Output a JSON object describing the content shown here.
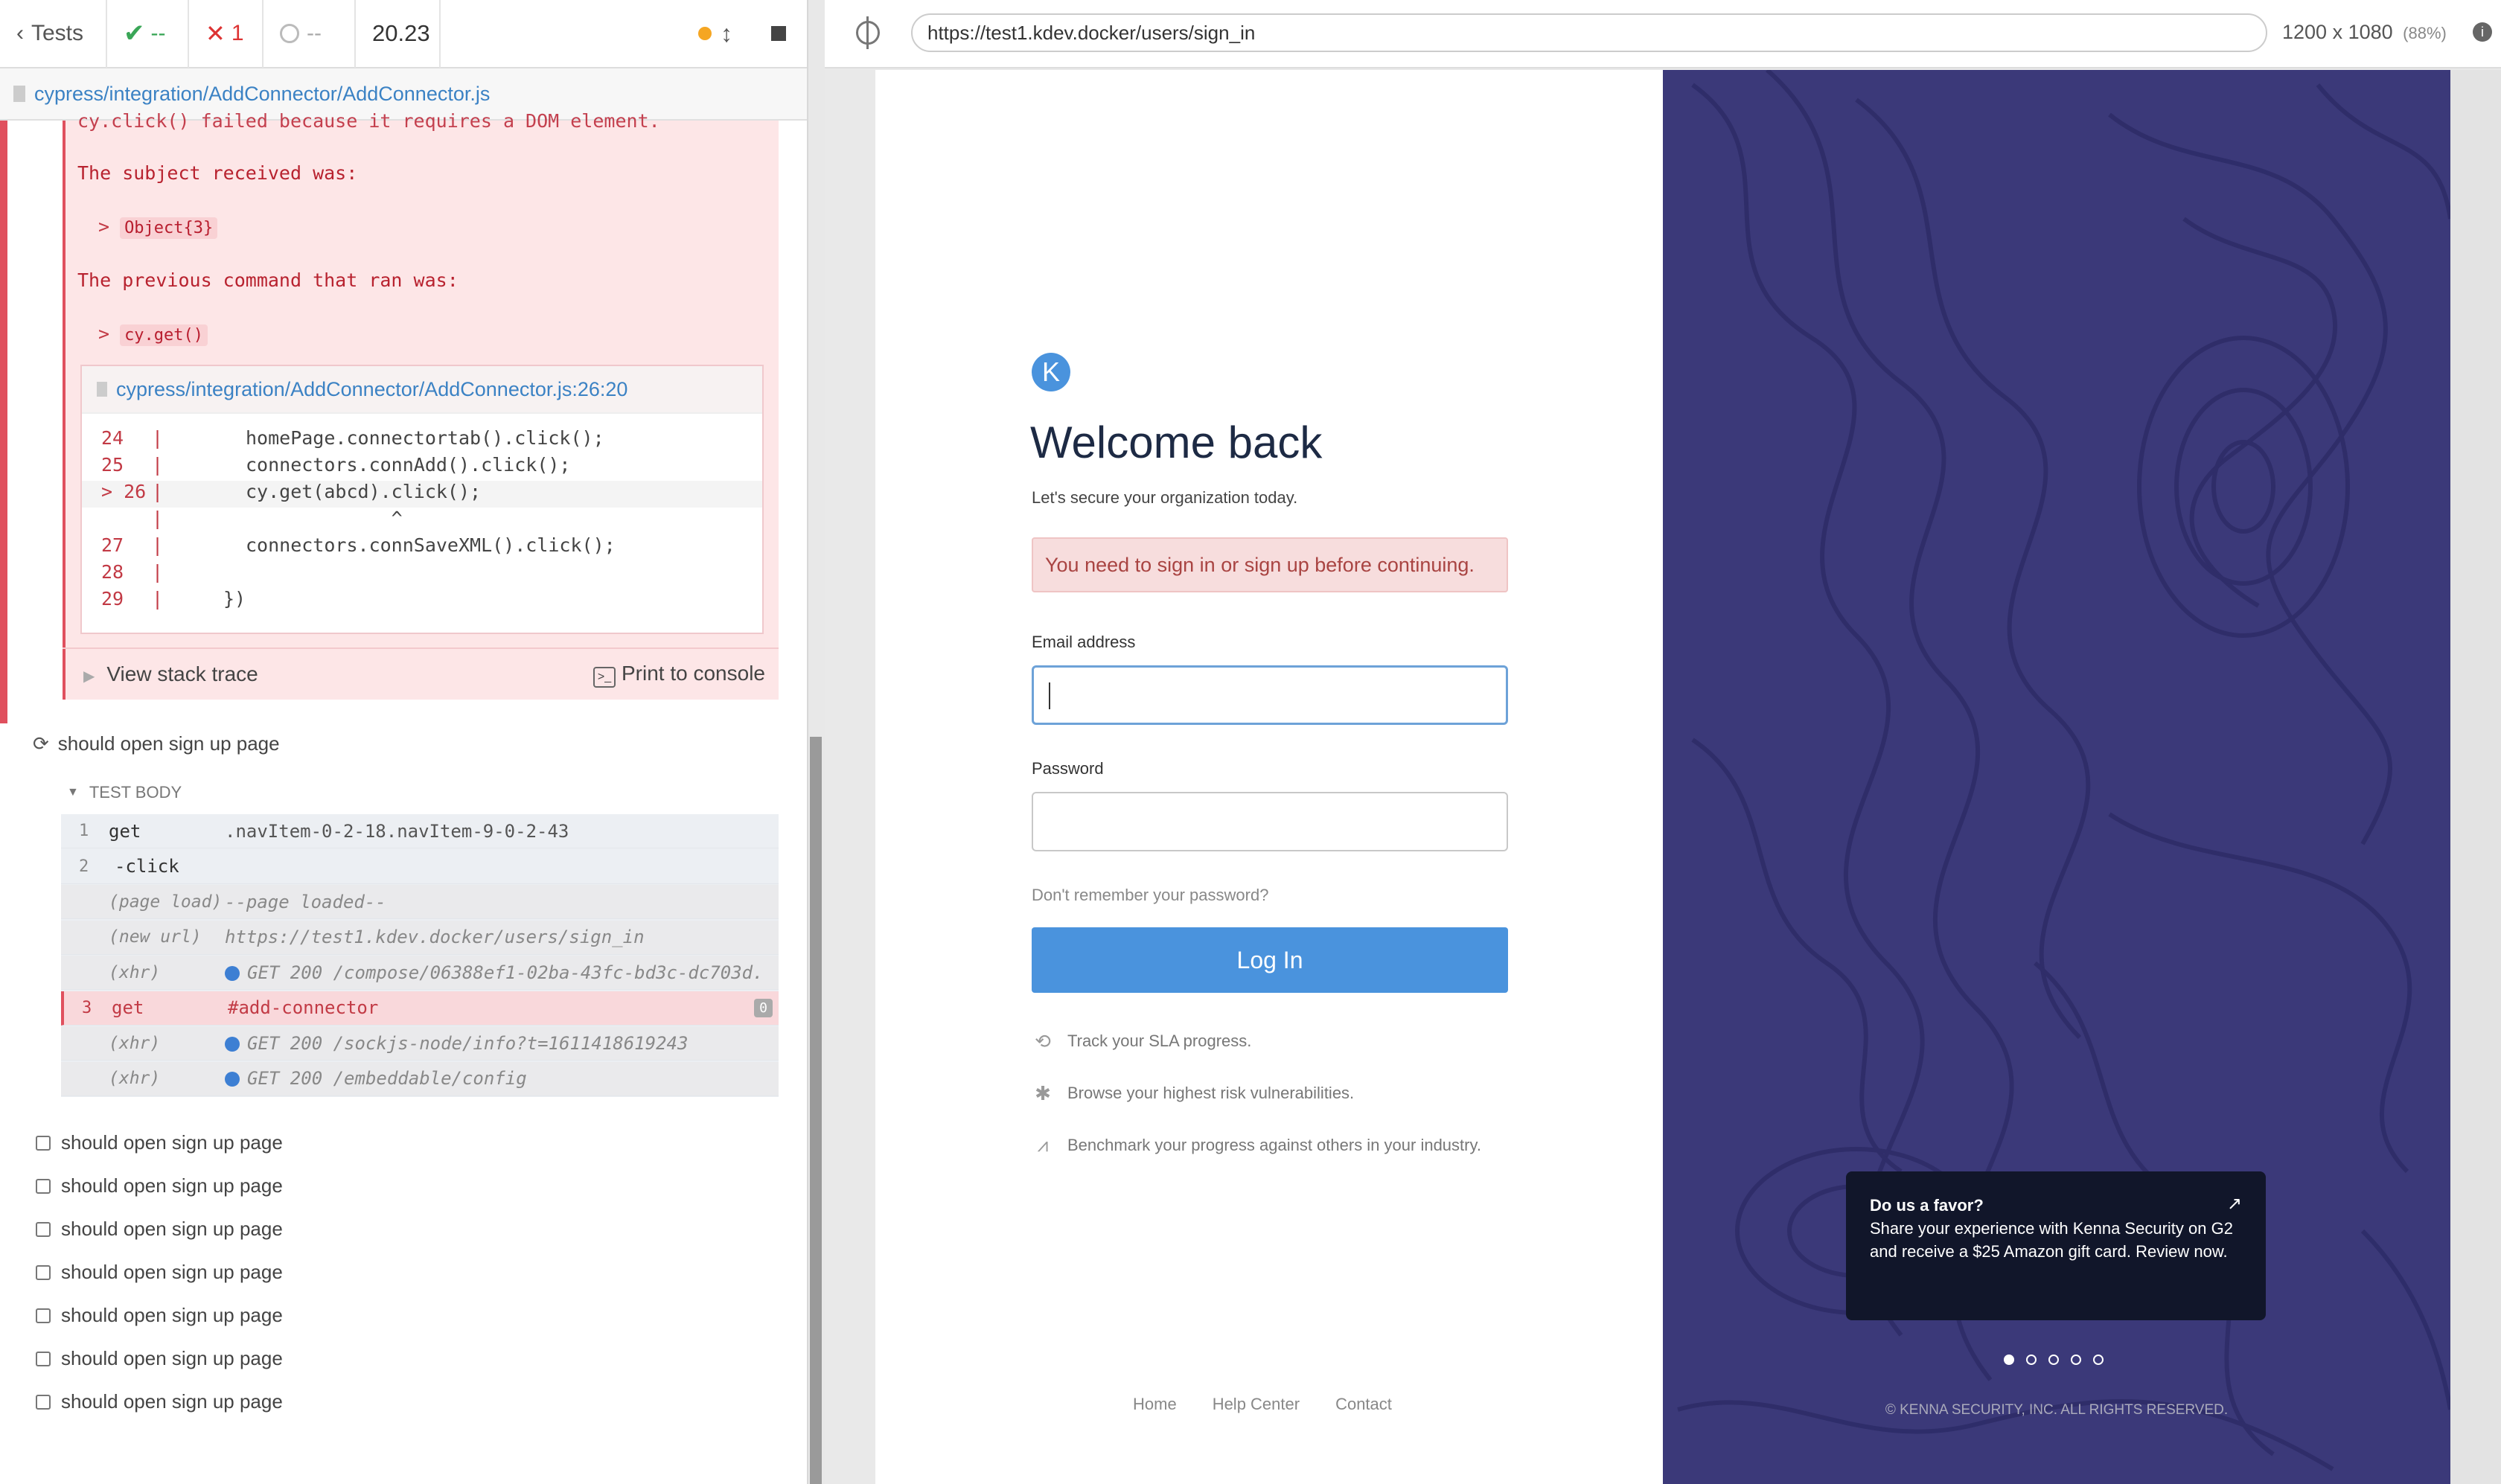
{
  "runner": {
    "tests_label": "Tests",
    "passed": "--",
    "failed": "1",
    "pending": "--",
    "duration": "20.23",
    "spec_file": "cypress/integration/AddConnector/AddConnector.js"
  },
  "error": {
    "cut_line": "cy.click() failed because it requires a DOM element.",
    "subject_label": "The subject received was:",
    "subject_value": "Object{3}",
    "previous_label": "The previous command that ran was:",
    "previous_value": "cy.get()",
    "code_file": "cypress/integration/AddConnector/AddConnector.js:26:20",
    "code_lines": [
      {
        "num": "24",
        "text": "homePage.connectortab().click();"
      },
      {
        "num": "25",
        "text": "connectors.connAdd().click();"
      },
      {
        "num": "> 26",
        "text": "cy.get(abcd).click();"
      },
      {
        "num": "",
        "text": "             ^"
      },
      {
        "num": "27",
        "text": "connectors.connSaveXML().click();"
      },
      {
        "num": "28",
        "text": ""
      },
      {
        "num": "29",
        "text": "})"
      }
    ],
    "view_stack": "View stack trace",
    "print_console": "Print to console"
  },
  "running_test": "should open sign up page",
  "test_body_label": "TEST BODY",
  "commands": [
    {
      "num": "1",
      "name": "get",
      "msg": ".navItem-0-2-18.navItem-9-0-2-43"
    },
    {
      "num": "2",
      "name": "-click",
      "msg": ""
    },
    {
      "num": "",
      "name": "(page load)",
      "msg": "--page loaded--"
    },
    {
      "num": "",
      "name": "(new url)",
      "msg": "https://test1.kdev.docker/users/sign_in"
    },
    {
      "num": "",
      "name": "(xhr)",
      "msg": "GET 200 /compose/06388ef1-02ba-43fc-bd3c-dc703d..."
    },
    {
      "num": "3",
      "name": "get",
      "msg": "#add-connector",
      "badge": "0"
    },
    {
      "num": "",
      "name": "(xhr)",
      "msg": "GET 200 /sockjs-node/info?t=1611418619243"
    },
    {
      "num": "",
      "name": "(xhr)",
      "msg": "GET 200 /embeddable/config"
    }
  ],
  "pending_tests": [
    "should open sign up page",
    "should open sign up page",
    "should open sign up page",
    "should open sign up page",
    "should open sign up page",
    "should open sign up page",
    "should open sign up page"
  ],
  "browser": {
    "url": "https://test1.kdev.docker/users/sign_in",
    "viewport": "1200 x 1080",
    "zoom": "(88%)"
  },
  "signin": {
    "logo_letter": "K",
    "title": "Welcome back",
    "subtitle": "Let's secure your organization today.",
    "alert": "You need to sign in or sign up before continuing.",
    "email_label": "Email address",
    "password_label": "Password",
    "forgot": "Don't remember your password?",
    "login_button": "Log In",
    "features": [
      {
        "icon": "history-icon",
        "text": "Track your SLA progress."
      },
      {
        "icon": "bug-icon",
        "text": "Browse your highest risk vulnerabilities."
      },
      {
        "icon": "chart-icon",
        "text": "Benchmark your progress against others in your industry."
      }
    ],
    "footer": [
      "Home",
      "Help Center",
      "Contact"
    ]
  },
  "promo": {
    "title": "Do us a favor?",
    "body": "Share your experience with Kenna Security on G2 and receive a $25 Amazon gift card. Review now.",
    "copyright": "© KENNA SECURITY, INC. ALL RIGHTS RESERVED.",
    "active_slide": 1,
    "slide_count": 5
  },
  "colors": {
    "error_red": "#e0505e",
    "link_blue": "#3b82c4",
    "brand_blue": "#4a93dd",
    "promo_bg": "#3b3979"
  }
}
